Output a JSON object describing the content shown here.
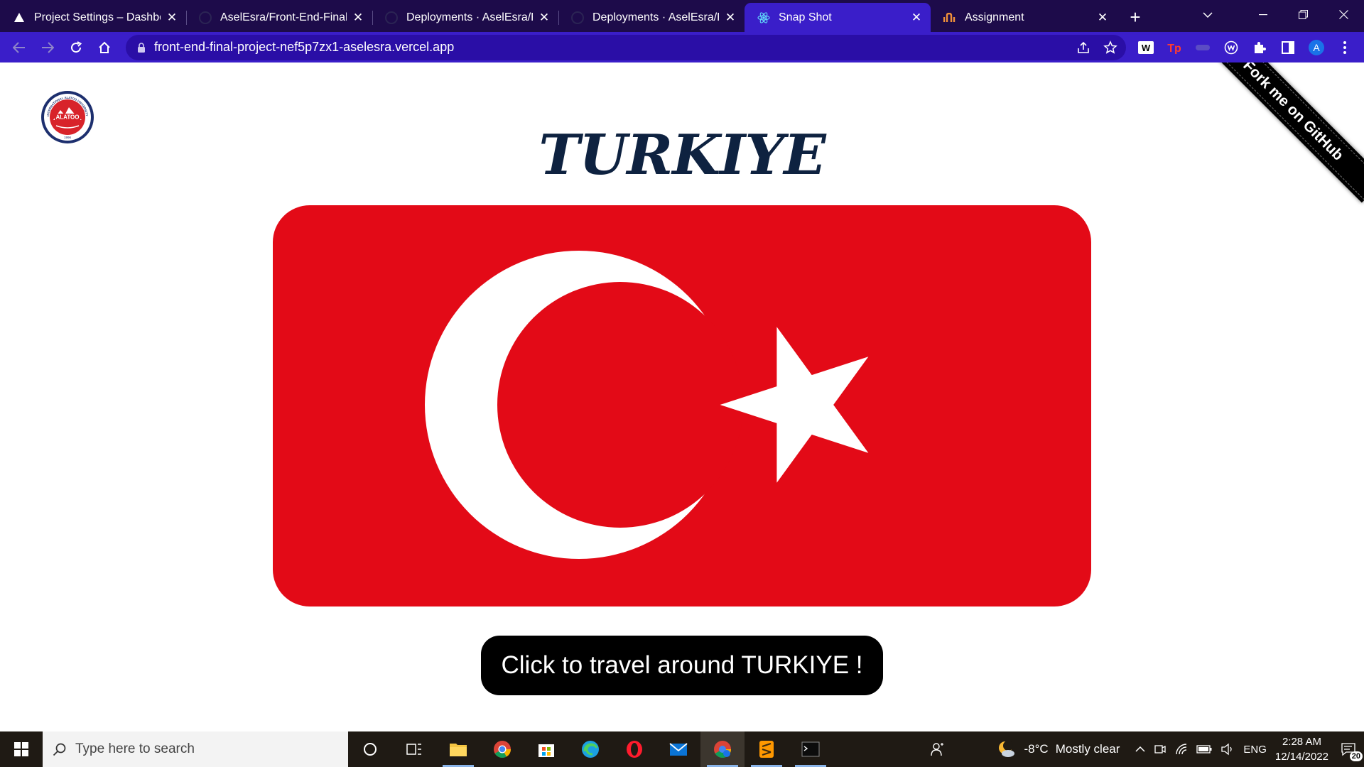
{
  "browser": {
    "tabs": [
      {
        "title": "Project Settings – Dashboard",
        "icon": "vercel-icon",
        "active": false
      },
      {
        "title": "AselEsra/Front-End-Final-Project",
        "icon": "github-icon",
        "active": false
      },
      {
        "title": "Deployments · AselEsra/Front-End",
        "icon": "github-icon",
        "active": false
      },
      {
        "title": "Deployments · AselEsra/Front-End",
        "icon": "github-icon",
        "active": false
      },
      {
        "title": "Snap Shot",
        "icon": "react-icon",
        "active": true
      },
      {
        "title": "Assignment",
        "icon": "assignment-icon",
        "active": false
      }
    ],
    "url": "front-end-final-project-nef5p7zx1-aselesra.vercel.app",
    "profile_initial": "A",
    "colors": {
      "frame": "#1d0b4a",
      "toolbar": "#3a1ec9",
      "omnibox": "#2a0ea6"
    }
  },
  "page": {
    "title": "TURKIYE",
    "cta_label": "Click to travel around TURKIYE !",
    "ribbon_label": "Fork me on GitHub",
    "logo": {
      "top_text": "INTERNATIONAL ALATOO UNIVERSITY",
      "center_text": "ALATOO",
      "year": "1996"
    },
    "colors": {
      "flag_red": "#e30a17",
      "title": "#0e2240",
      "cta_bg": "#000000"
    }
  },
  "taskbar": {
    "search_placeholder": "Type here to search",
    "weather_temp": "-8°C",
    "weather_text": "Mostly clear",
    "language": "ENG",
    "time": "2:28 AM",
    "date": "12/14/2022",
    "notification_count": "20"
  }
}
